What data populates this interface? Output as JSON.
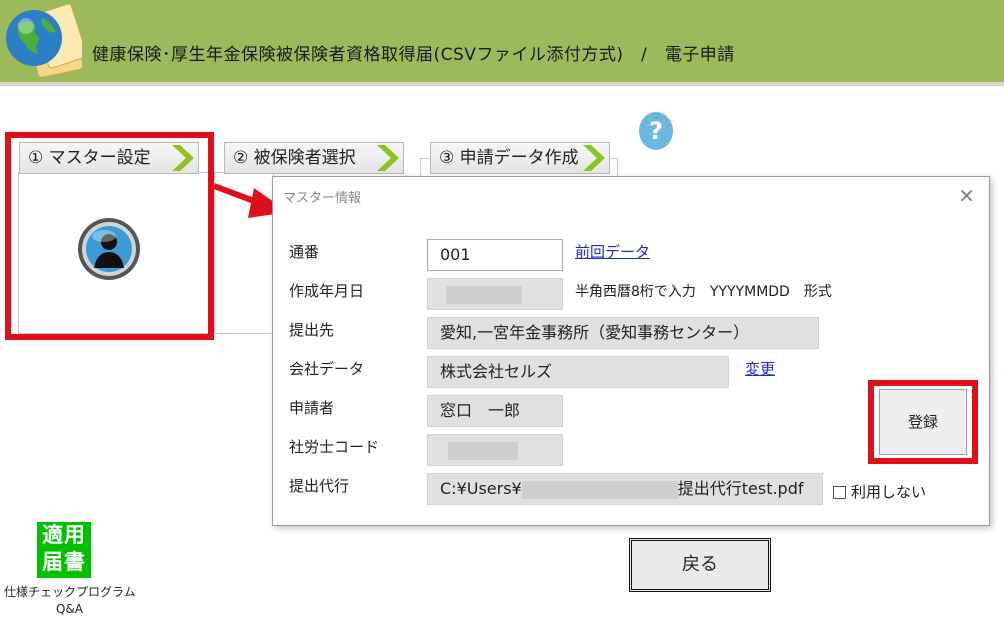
{
  "header": {
    "title": "健康保険･厚生年金保険被保険者資格取得届(CSVファイル添付方式)　/　電子申請",
    "bg_color": "#9aba5c"
  },
  "help": {
    "label": "?"
  },
  "tabs": [
    {
      "label": "① マスター設定"
    },
    {
      "label": "② 被保険者選択"
    },
    {
      "label": "③ 申請データ作成"
    }
  ],
  "dialog": {
    "title": "マスター情報",
    "close": "×",
    "fields": {
      "serial": {
        "label": "通番",
        "value": "001",
        "link": "前回データ"
      },
      "date": {
        "label": "作成年月日",
        "note": "半角西暦8桁で入力　YYYYMMDD　形式"
      },
      "destination": {
        "label": "提出先",
        "value": "愛知,一宮年金事務所（愛知事務センター）"
      },
      "company": {
        "label": "会社データ",
        "value": "株式会社セルズ",
        "link": "変更"
      },
      "applicant": {
        "label": "申請者",
        "value": "窓口　一郎"
      },
      "sharoushi": {
        "label": "社労士コード"
      },
      "proxy": {
        "label": "提出代行",
        "value_prefix": "C:¥Users¥",
        "value_suffix": "提出代行test.pdf",
        "checkbox_label": "利用しない"
      }
    },
    "register_button": "登録"
  },
  "back_button": "戻る",
  "tekiyo": {
    "line1": "適用",
    "line2": "届書"
  },
  "program": {
    "line1": "仕様チェックプログラム",
    "line2": "Q&A"
  },
  "colors": {
    "highlight": "#e0101a",
    "link": "#1a2ccf",
    "accent_green": "#00c000"
  }
}
